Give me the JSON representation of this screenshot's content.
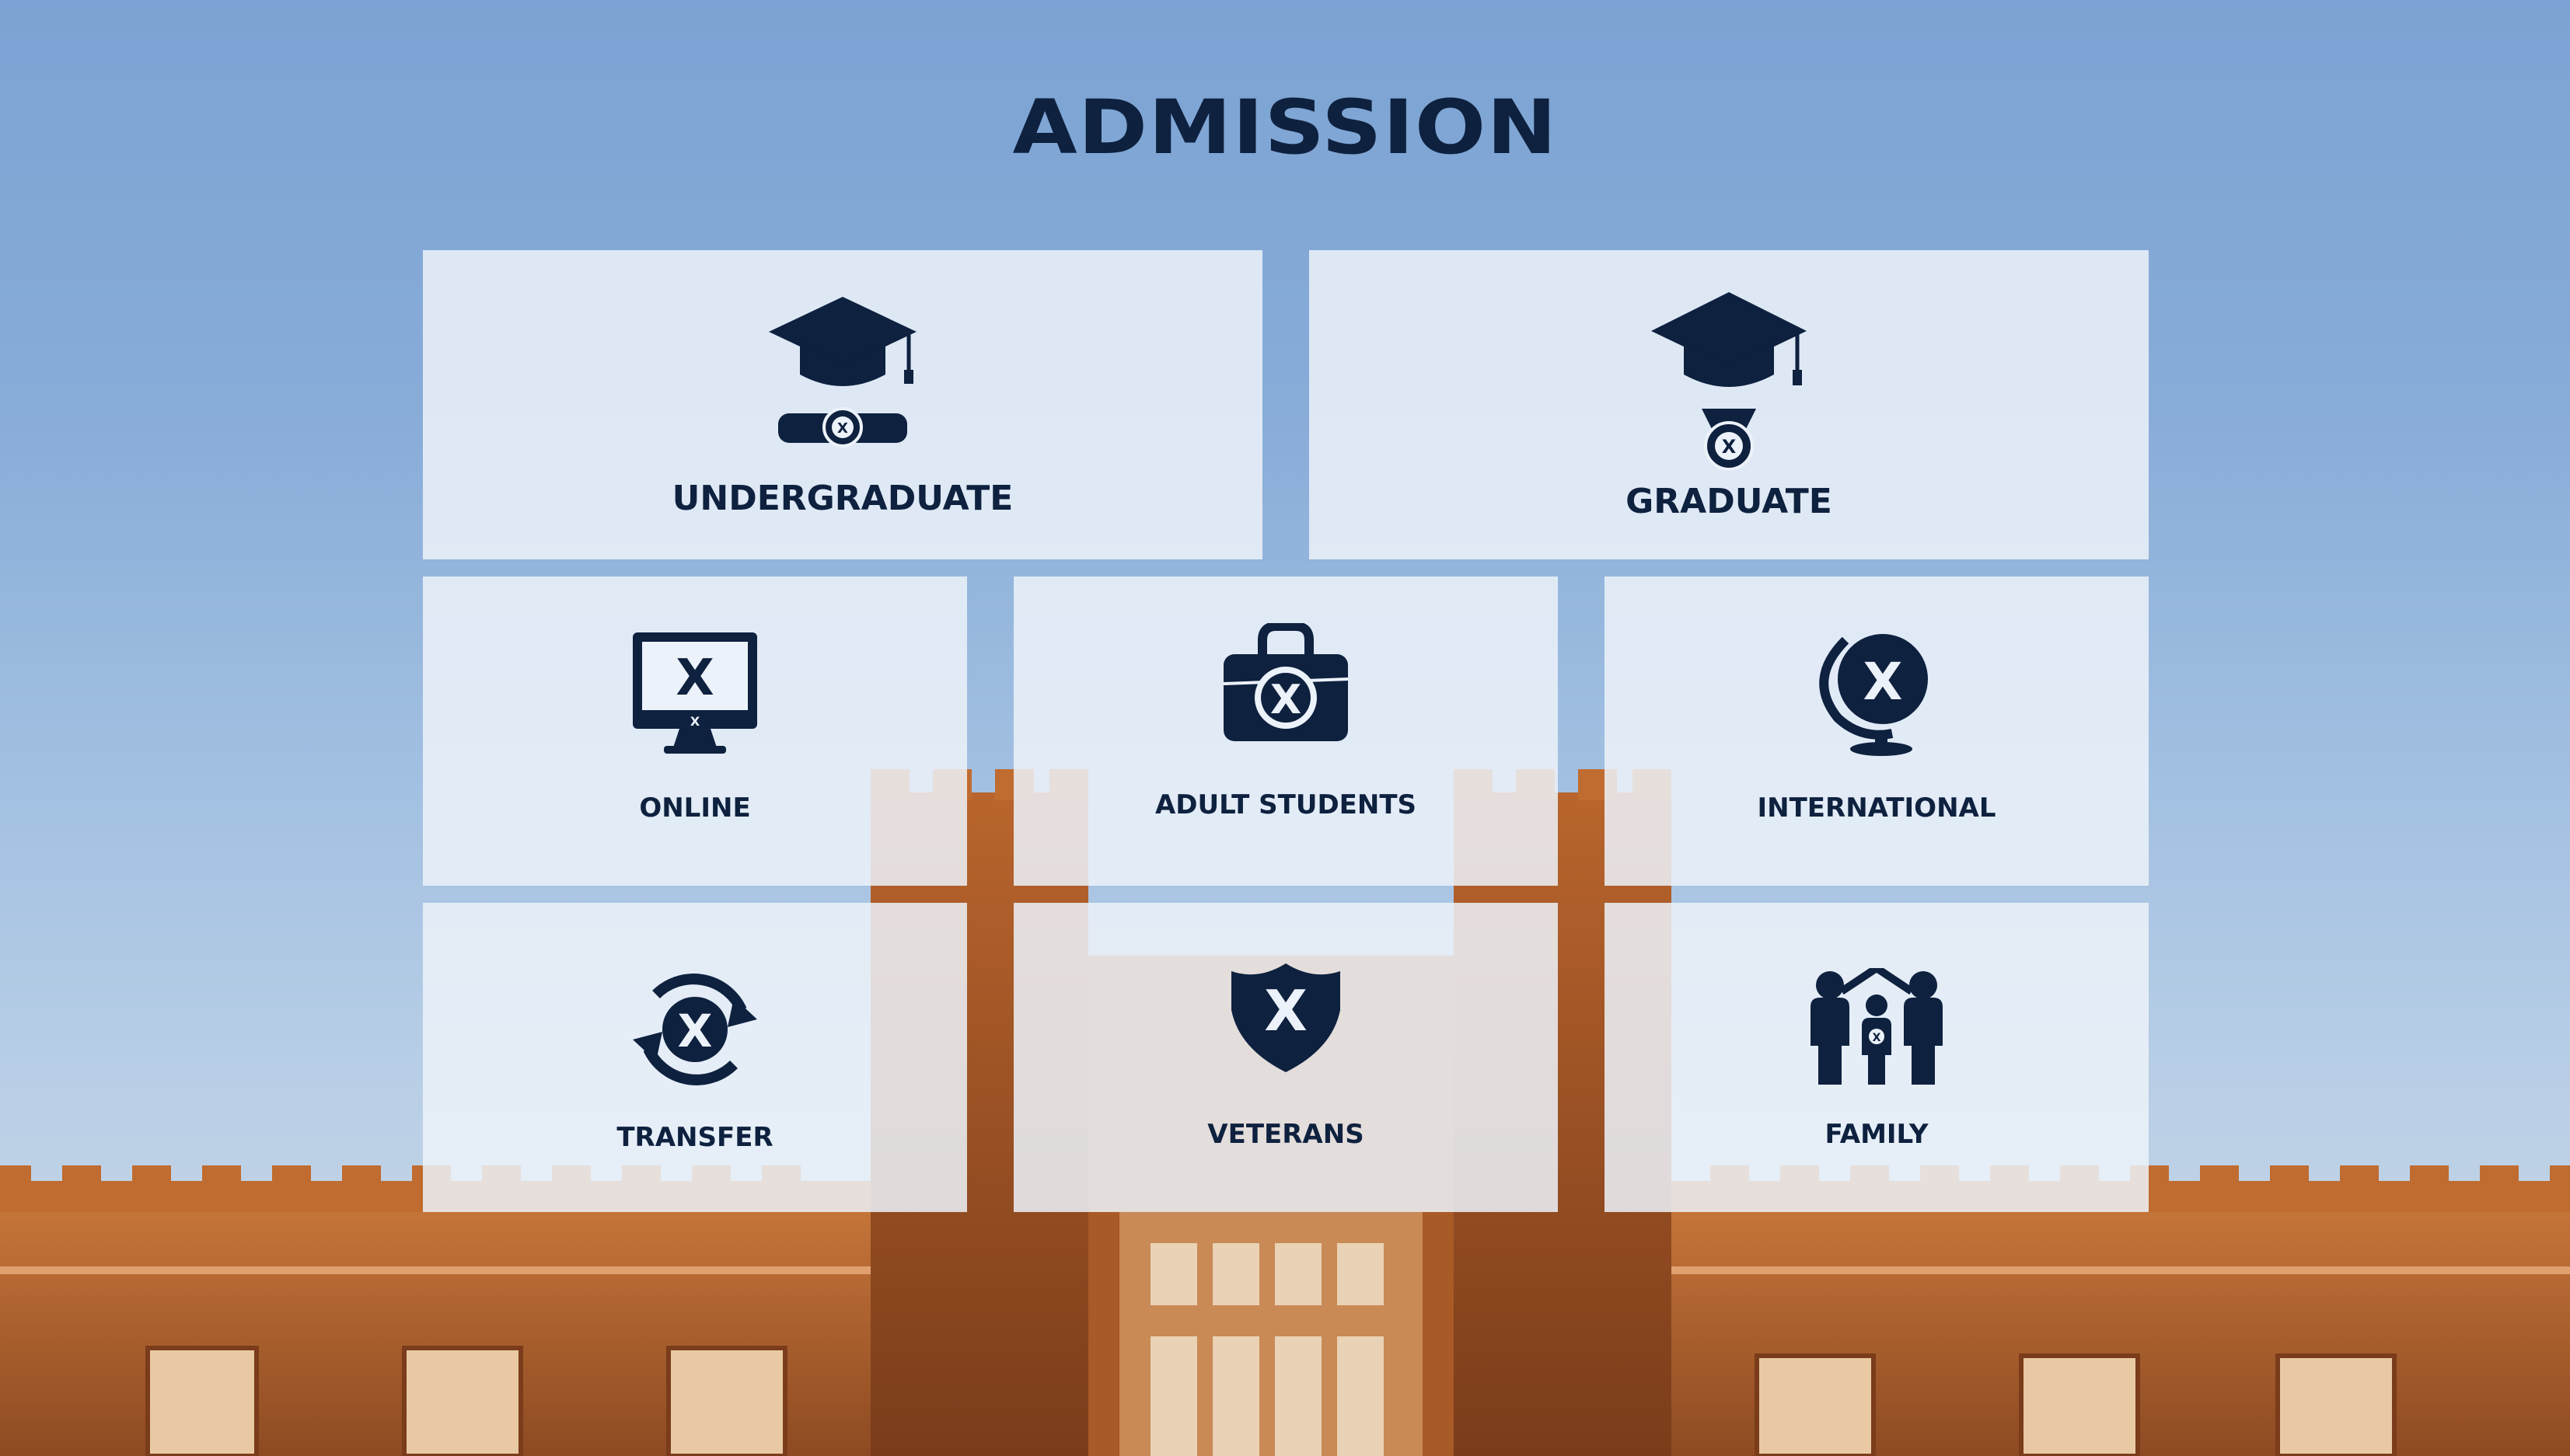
{
  "page": {
    "title": "ADMISSION"
  },
  "theme": {
    "navy": "#0e213f",
    "tile_background": "#ecf2f9",
    "sky": "#7ba3d3",
    "brick": "#b8642a"
  },
  "tiles": [
    {
      "label": "UNDERGRADUATE",
      "icon": "graduation-cap-diploma-icon"
    },
    {
      "label": "GRADUATE",
      "icon": "graduation-cap-medal-icon"
    },
    {
      "label": "ONLINE",
      "icon": "computer-monitor-icon"
    },
    {
      "label": "ADULT STUDENTS",
      "icon": "briefcase-icon"
    },
    {
      "label": "INTERNATIONAL",
      "icon": "globe-icon"
    },
    {
      "label": "TRANSFER",
      "icon": "transfer-arrows-icon"
    },
    {
      "label": "VETERANS",
      "icon": "shield-icon"
    },
    {
      "label": "FAMILY",
      "icon": "family-house-icon"
    }
  ]
}
